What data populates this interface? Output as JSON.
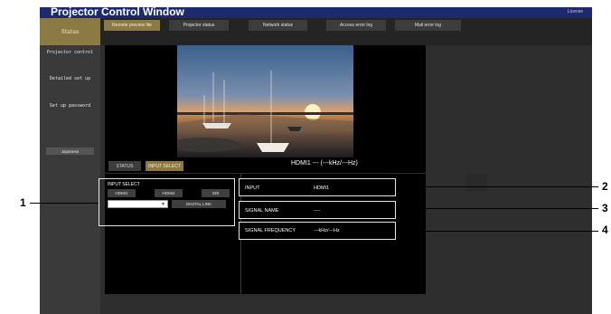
{
  "window": {
    "title": "Projector Control Window",
    "license_link": "License"
  },
  "top_tabs": [
    "Remote preview lite",
    "Projector status",
    "Network status",
    "Access error log",
    "Mail error log"
  ],
  "active_top_tab": "Remote preview lite",
  "sidebar": {
    "status_label": "Status",
    "items": [
      "Projector control",
      "Detailed set up",
      "Set up password"
    ],
    "language_button": "Japanese"
  },
  "preview": {
    "sub_tabs": [
      "STATUS",
      "INPUT SELECT"
    ],
    "active_sub_tab": "INPUT SELECT",
    "signal_line": "HDMI1 --- (---kHz/---Hz)"
  },
  "input_select": {
    "title": "INPUT SELECT",
    "buttons": [
      "HDMI1",
      "HDMI2",
      "SDI"
    ],
    "dropdown_value": "",
    "digital_link_button": "DIGITAL LINK"
  },
  "info": {
    "input_label": "INPUT",
    "input_value": "HDMI1",
    "signal_name_label": "SIGNAL NAME",
    "signal_name_value": "----",
    "signal_frequency_label": "SIGNAL FREQUENCY",
    "signal_frequency_value": "---kHz/---Hz"
  },
  "callouts": [
    "1",
    "2",
    "3",
    "4"
  ]
}
